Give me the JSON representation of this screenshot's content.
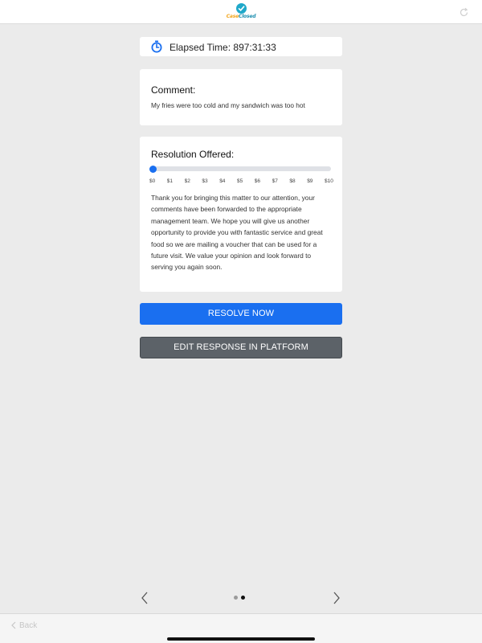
{
  "header": {
    "logo_text_1": "Case",
    "logo_text_2": "Closed",
    "logo_icon": "check-circle-icon",
    "refresh_icon": "refresh-icon"
  },
  "timer": {
    "icon": "stopwatch-icon",
    "label": "Elapsed Time:",
    "value": "897:31:33",
    "full": "Elapsed Time: 897:31:33"
  },
  "comment": {
    "title": "Comment:",
    "body": "My fries were too cold and my sandwich was too hot"
  },
  "resolution": {
    "title": "Resolution Offered:",
    "slider_value": 0,
    "slider_min": 0,
    "slider_max": 10,
    "ticks": [
      "$0",
      "$1",
      "$2",
      "$3",
      "$4",
      "$5",
      "$6",
      "$7",
      "$8",
      "$9",
      "$10"
    ],
    "message": "Thank you for bringing this matter to our attention, your comments have been forwarded to the appropriate management team. We hope you will give us another opportunity to provide you with fantastic service and great food so we are mailing a voucher that can be used for a future visit. We value your opinion and look forward to serving you again soon."
  },
  "buttons": {
    "resolve": "RESOLVE NOW",
    "edit": "EDIT RESPONSE IN PLATFORM"
  },
  "pager": {
    "pages": 2,
    "current": 2,
    "prev_icon": "chevron-left-icon",
    "next_icon": "chevron-right-icon"
  },
  "footer": {
    "back_label": "Back",
    "back_icon": "chevron-left-icon"
  },
  "colors": {
    "primary": "#1a6ff0",
    "secondary": "#5c6268",
    "background": "#ebebeb"
  }
}
